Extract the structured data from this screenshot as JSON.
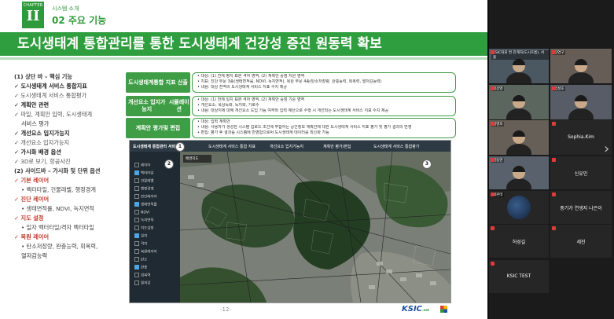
{
  "slide": {
    "chapter_label": "CHAPTER",
    "chapter_number": "II",
    "section_sub": "시스템 소개",
    "section_title": "02 주요 기능",
    "banner": "도시생태계 통합관리를 통한 도시생태계 건강성 증진 원동력 확보",
    "left_list": [
      {
        "text": "(1) 상단 바 – 핵심 기능",
        "style": "head"
      },
      {
        "text": "✓ 도시생태계 서비스 통합지표",
        "style": "check-bold"
      },
      {
        "text": "✓ 도시생태계 서비스 통합평가",
        "style": "check"
      },
      {
        "text": "✓ 계획안 관련",
        "style": "check-bold"
      },
      {
        "text": "✓ 파일, 계획안 입력, 도시생태계",
        "style": "check"
      },
      {
        "text": "서비스 평가",
        "style": "indent"
      },
      {
        "text": "✓ 개선요소 입지가능지",
        "style": "check-bold"
      },
      {
        "text": "✓ 개선요소 입지가능지",
        "style": "check"
      },
      {
        "text": "✓ 가시화 배경 옵션",
        "style": "check-bold"
      },
      {
        "text": "✓ 3D로 보기, 항공사진",
        "style": "check"
      },
      {
        "text": "(2) 사이드바 – 가시화 및 단위 옵션",
        "style": "head"
      },
      {
        "text": "✓ 기본 레이어",
        "style": "check-red"
      },
      {
        "text": "• 벡터타일, 건물레벨, 행정경계",
        "style": "dot"
      },
      {
        "text": "✓ 진단 레이어",
        "style": "check-red"
      },
      {
        "text": "• 생태면적률, NDVI, 녹지면적",
        "style": "dot"
      },
      {
        "text": "✓ 지도 설정",
        "style": "check-red"
      },
      {
        "text": "• 일자 벡터타일/격자 벡터타일",
        "style": "dot"
      },
      {
        "text": "✓ 복원 레이어",
        "style": "check-red"
      },
      {
        "text": "• 탄소저장량, 완충능력, 회복력,",
        "style": "dot"
      },
      {
        "text": "열저감능력",
        "style": "indent"
      }
    ],
    "boxes": [
      {
        "label": "도시생태계\n통합 지표 산출",
        "lines": [
          "• 대상: (1) 전체 평지 표본 격자 영역, (2) 계획안 중점 지원 영역",
          "• 지표: 진단 부문 3종(생태면적률, NDVI, 녹지면적), 복원 부문 4종(탄소저장량, 완충능력, 회복력, 열저감능력)",
          "• 내용: 대상 전역의 도시생태계 서비스 지표 수치 제공"
        ]
      },
      {
        "label": "개선요소 입지가능지\n시뮬레이션",
        "lines": [
          "• 대상: (1) 전체 일치 표본 격자 영역, (2) 계획안 중점 기준 영역",
          "• 개선요소: 옥상녹화, 녹지화, 가로수",
          "• 내용: 대상지에 대해 개선요소 도입 가능 여부와 입력 예산으로 수행 시 개선되는 도시생태계 서비스 지표 수치 제공"
        ]
      },
      {
        "label": "계획안 평가\n및 편집",
        "lines": [
          "• 대상: 입력 계획안",
          "• 내용: 사용자가 생성한 시스템 업로드 조건에 부합하는 공간정보 계획안에 대한 도시생태계 서비스 지표 평가 및 평가 결과의 반영",
          "• 편집: 평가 후 결과를 시스템에 반영함으로써 도시생태계 데이터를 최신화 가능"
        ]
      }
    ],
    "app": {
      "title": "도시생태계 통합관리 서비스",
      "tabs": [
        "도시생태계 서비스 통합 지표",
        "개선요소 입지가능지",
        "계획안 평가/편집",
        "도시생태계 서비스 통합평가"
      ],
      "side_items": [
        "레이어",
        "벡터타일",
        "건물레벨",
        "행정경계",
        "진단레이어",
        "생태면적률",
        "NDVI",
        "녹지면적",
        "지도설정",
        "일자",
        "격자",
        "복원레이어",
        "탄소",
        "완충",
        "회복력",
        "열저감"
      ],
      "map_label": "배경지도",
      "markers": [
        "1",
        "2",
        "3"
      ]
    },
    "page_number": "-12-",
    "logo": "KSIC",
    "logo_sub": ".net"
  },
  "participants": [
    {
      "name": "KSIC대표 컨 관계자(도시흐름), 서울",
      "type": "video"
    },
    {
      "name": "김연구",
      "type": "video"
    },
    {
      "name": "정상영",
      "type": "video"
    },
    {
      "name": "임성호",
      "type": "video"
    },
    {
      "name": "정명호",
      "type": "video"
    },
    {
      "name": "",
      "type": "video"
    },
    {
      "name": "Sophia.Kim",
      "type": "name"
    },
    {
      "name": "김동연",
      "type": "video"
    },
    {
      "name": "신유민",
      "type": "name"
    },
    {
      "name": "레몬테",
      "type": "avatar"
    },
    {
      "name": "중기가 연생지 나은이",
      "type": "name"
    },
    {
      "name": "허성길",
      "type": "name"
    },
    {
      "name": "세진",
      "type": "name"
    },
    {
      "name": "KSIC TEST",
      "type": "name"
    }
  ],
  "colors": {
    "accent": "#2f9e3e",
    "box": "#3f9d46",
    "logo": "#1d4f9e"
  },
  "icons": [
    "microphone-muted-icon",
    "chevron-right-icon"
  ]
}
